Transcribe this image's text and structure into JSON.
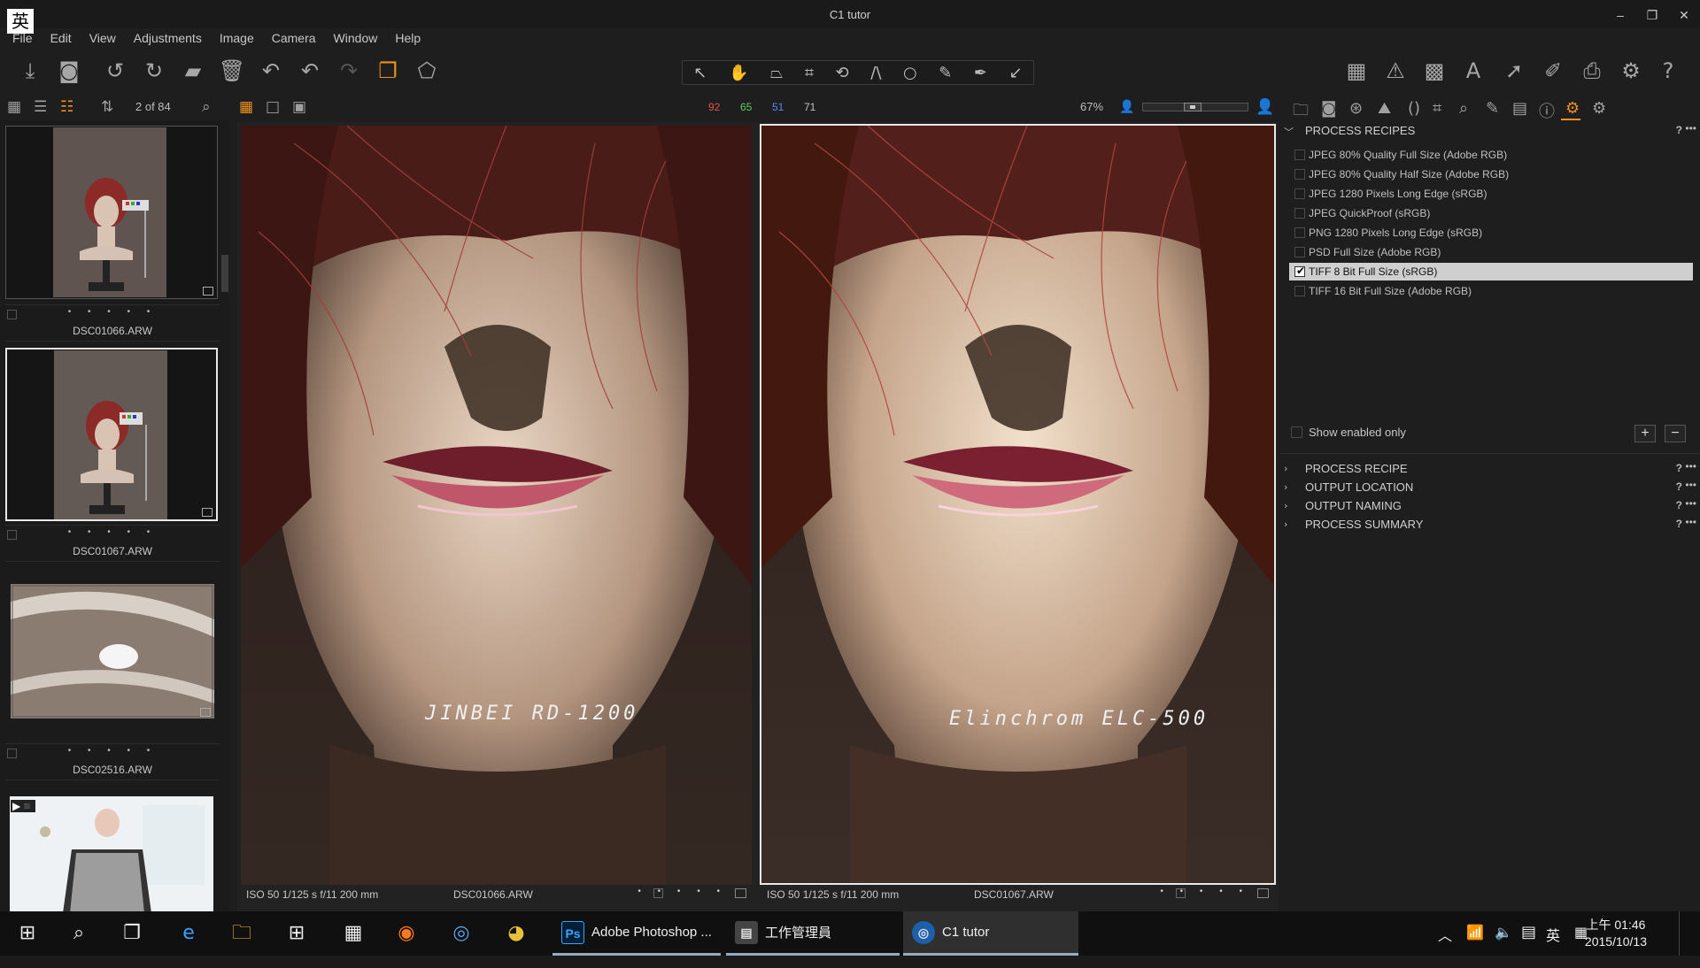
{
  "window": {
    "title": "C1 tutor",
    "ime_badge": "英",
    "min": "–",
    "max": "❐",
    "close": "✕"
  },
  "menu": [
    "File",
    "Edit",
    "View",
    "Adjustments",
    "Image",
    "Camera",
    "Window",
    "Help"
  ],
  "browser": {
    "count": "2 of 84",
    "items": [
      {
        "name": "DSC01066.ARW",
        "rating": "• • • • •",
        "selected": false
      },
      {
        "name": "DSC01067.ARW",
        "rating": "• • • • •",
        "selected": true
      },
      {
        "name": "DSC02516.ARW",
        "rating": "• • • • •",
        "selected": false
      }
    ]
  },
  "stats": {
    "red": "92",
    "green": "65",
    "blue": "51",
    "gray": "71",
    "zoom": "67%"
  },
  "colors": {
    "red": "#e0544a",
    "green": "#5fcf5b",
    "blue": "#5a84ff",
    "gray": "#c0c0c0",
    "accent": "#f0901e"
  },
  "viewer": {
    "left": {
      "exif": "ISO 50  1/125 s  f/11  200 mm",
      "file": "DSC01066.ARW",
      "rating": "• • • • •",
      "caption": "JINBEI RD-1200"
    },
    "right": {
      "exif": "ISO 50  1/125 s  f/11  200 mm",
      "file": "DSC01067.ARW",
      "rating": "• • • • •",
      "caption": "Elinchrom ELC-500"
    }
  },
  "panel": {
    "recipes_title": "PROCESS RECIPES",
    "recipes": [
      "JPEG 80% Quality Full Size (Adobe RGB)",
      "JPEG 80% Quality Half Size (Adobe RGB)",
      "JPEG 1280 Pixels Long Edge (sRGB)",
      "JPEG QuickProof (sRGB)",
      "PNG 1280 Pixels Long Edge (sRGB)",
      "PSD Full Size (Adobe RGB)",
      "TIFF 8 Bit Full Size (sRGB)",
      "TIFF 16 Bit Full Size (Adobe RGB)"
    ],
    "selected_recipe_index": 6,
    "show_enabled_only": "Show enabled only",
    "add": "+",
    "remove": "−",
    "help": "?",
    "more": "•••",
    "sections": [
      "PROCESS RECIPE",
      "OUTPUT LOCATION",
      "OUTPUT NAMING",
      "PROCESS SUMMARY"
    ]
  },
  "taskbar": {
    "apps": [
      {
        "label": "Adobe Photoshop ...",
        "icon": "Ps",
        "icon_color": "#31a8ff",
        "icon_bg": "#001e36"
      },
      {
        "label": "工作管理員",
        "icon": "▤",
        "icon_color": "#ccc",
        "icon_bg": "#444"
      },
      {
        "label": "C1 tutor",
        "icon": "◎",
        "icon_color": "#cde",
        "icon_bg": "#1d5fa8"
      }
    ],
    "time": "上午 01:46",
    "date": "2015/10/13",
    "ime": "英"
  }
}
